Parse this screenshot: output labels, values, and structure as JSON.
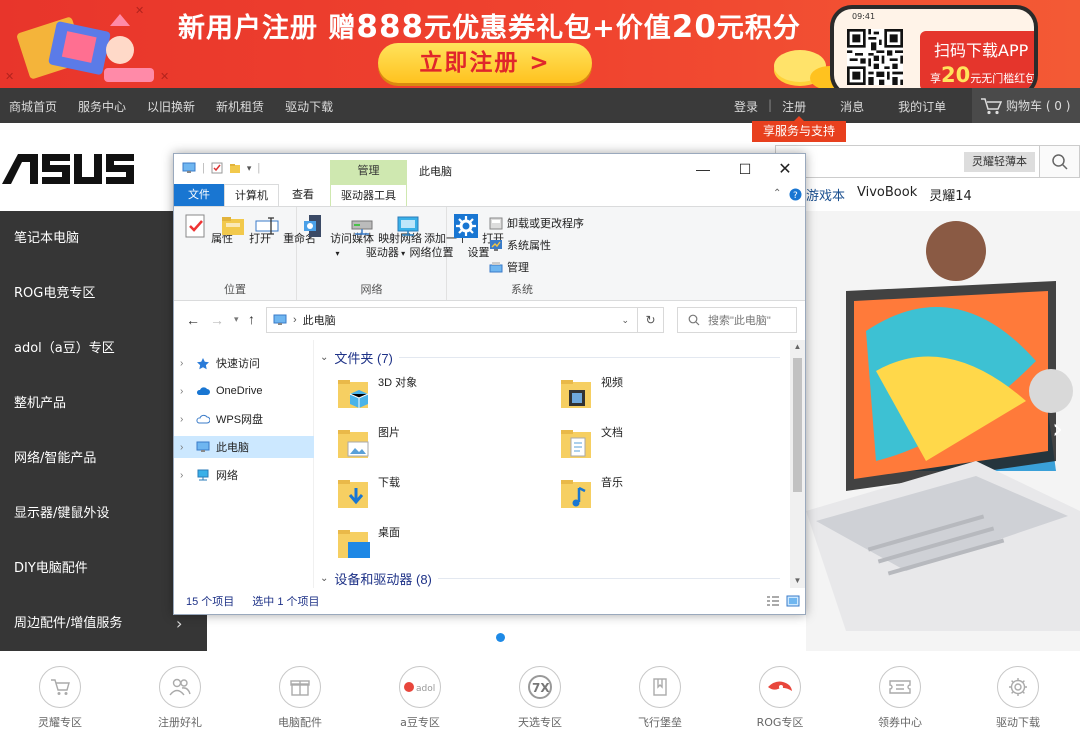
{
  "banner": {
    "headline_prefix": "新用户注册  赠",
    "headline_amount": "888",
    "headline_mid": "元优惠券礼包+价值",
    "headline_points": "20",
    "headline_suffix": "元积分",
    "cta_label": "立即注册 >",
    "phone_time": "09:41",
    "app_line1": "扫码下载APP",
    "app_line2_prefix": "享",
    "app_line2_amount": "20",
    "app_line2_suffix": "元无门槛红包"
  },
  "topnav": {
    "left_links": [
      "商城首页",
      "服务中心",
      "以旧换新",
      "新机租赁",
      "驱动下载"
    ],
    "login": "登录",
    "separator": "|",
    "register": "注册",
    "messages": "消息",
    "orders": "我的订单",
    "cart_label": "购物车 ( 0 )",
    "tooltip": "享服务与支持"
  },
  "header": {
    "logo_text": "/ISUS",
    "search_tag": "灵耀轻薄本",
    "hot_words": [
      "游戏本",
      "VivoBook",
      "灵耀14"
    ]
  },
  "category_menu": {
    "items": [
      "笔记本电脑",
      "ROG电竞专区",
      "adol（a豆）专区",
      "整机产品",
      "网络/智能产品",
      "显示器/键鼠外设",
      "DIY电脑配件"
    ],
    "last_item": "周边配件/增值服务"
  },
  "bottom_icons": [
    {
      "label": "灵耀专区",
      "icon": "cart-icon"
    },
    {
      "label": "注册好礼",
      "icon": "users-icon"
    },
    {
      "label": "电脑配件",
      "icon": "gift-icon"
    },
    {
      "label": "a豆专区",
      "icon": "adol-icon",
      "badge": "adol"
    },
    {
      "label": "天选专区",
      "icon": "tianxuan-icon",
      "badge": "7X"
    },
    {
      "label": "飞行堡垒",
      "icon": "bookmark-icon"
    },
    {
      "label": "ROG专区",
      "icon": "rog-icon"
    },
    {
      "label": "领券中心",
      "icon": "coupon-icon"
    },
    {
      "label": "驱动下载",
      "icon": "gear-icon"
    }
  ],
  "explorer": {
    "title": "此电脑",
    "context_group": "管理",
    "tabs": [
      "文件",
      "计算机",
      "查看",
      "驱动器工具"
    ],
    "ribbon": {
      "location_group": "位置",
      "network_group": "网络",
      "system_group": "系统",
      "properties": "属性",
      "open": "打开",
      "rename": "重命名",
      "access_media": "访问媒体",
      "map_drive_1": "映射网络",
      "map_drive_2": "驱动器",
      "add_location_1": "添加一个",
      "add_location_2": "网络位置",
      "open_settings_1": "打开",
      "open_settings_2": "设置",
      "uninstall": "卸载或更改程序",
      "sys_props": "系统属性",
      "manage": "管理"
    },
    "address": "此电脑",
    "search_placeholder": "搜索\"此电脑\"",
    "nav_items": [
      "快速访问",
      "OneDrive",
      "WPS网盘",
      "此电脑",
      "网络"
    ],
    "folders_header": "文件夹 (7)",
    "devices_header": "设备和驱动器 (8)",
    "folders": [
      "3D 对象",
      "视频",
      "图片",
      "文档",
      "下载",
      "音乐",
      "桌面"
    ],
    "status_count": "15 个项目",
    "status_selected": "选中 1 个项目"
  },
  "colors": {
    "banner_red": "#e8352b",
    "cta_yellow": "#ffc21f",
    "nav_dark": "#3a3a3a",
    "menu_dark": "#363636",
    "tooltip_orange": "#e8401e",
    "win_blue": "#1976d2",
    "selected_blue": "#cce8ff",
    "carousel_dot": "#1e8ae6"
  }
}
